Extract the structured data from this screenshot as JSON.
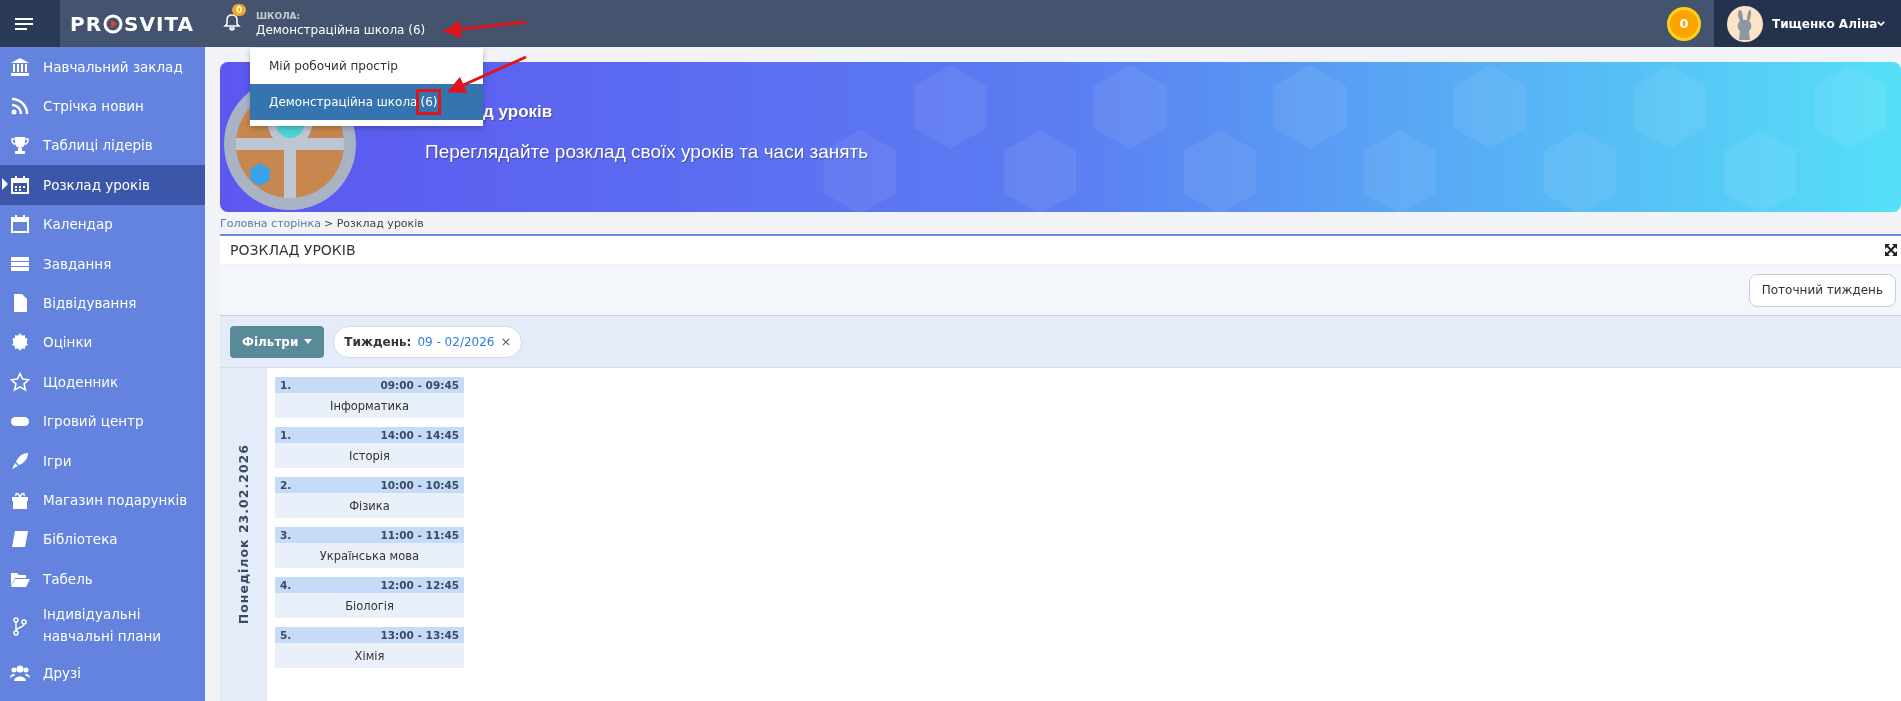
{
  "header": {
    "logo": {
      "before": "PR",
      "after": "SVITA"
    },
    "notifications": "0",
    "school_label": "ШКОЛА:",
    "school_name": "Демонстраційна школа (6)",
    "coins": "0",
    "user_name": "Тищенко Аліна"
  },
  "school_menu": [
    {
      "label": "Мій робочий простір",
      "selected": false,
      "highlighted": false
    },
    {
      "label": "Демонстраційна школа",
      "count": "(6)",
      "selected": true,
      "highlighted": true
    }
  ],
  "sidebar": {
    "items": [
      {
        "label": "Навчальний заклад",
        "selected": false
      },
      {
        "label": "Стрічка новин",
        "selected": false
      },
      {
        "label": "Таблиці лідерів",
        "selected": false
      },
      {
        "label": "Розклад уроків",
        "selected": true
      },
      {
        "label": "Календар",
        "selected": false
      },
      {
        "label": "Завдання",
        "selected": false
      },
      {
        "label": "Відвідування",
        "selected": false
      },
      {
        "label": "Оцінки",
        "selected": false
      },
      {
        "label": "Щоденник",
        "selected": false
      },
      {
        "label": "Ігровий центр",
        "selected": false
      },
      {
        "label": "Ігри",
        "selected": false
      },
      {
        "label": "Магазин подарунків",
        "selected": false
      },
      {
        "label": "Бібліотека",
        "selected": false
      },
      {
        "label": "Табель",
        "selected": false
      },
      {
        "label": "Індивідуальні навчальні плани",
        "selected": false
      },
      {
        "label": "Друзі",
        "selected": false
      }
    ]
  },
  "banner": {
    "title": "д уроків",
    "subtitle": "Переглядайте розклад своїх уроків та часи занять"
  },
  "breadcrumb": {
    "link": "Головна сторінка",
    "current": "> Розклад уроків"
  },
  "panel": {
    "title": "РОЗКЛАД УРОКІВ",
    "current_week_button": "Поточний тиждень",
    "filters_button": "Фільтри",
    "filter_chip": {
      "label": "Тиждень:",
      "value": "09 - 02/2026",
      "remove": "×"
    }
  },
  "schedule": {
    "days": [
      {
        "label": "Понеділок 23.02.2026",
        "lessons": [
          {
            "number": "1.",
            "time": "09:00 - 09:45",
            "subject": "Інформатика"
          },
          {
            "number": "1.",
            "time": "14:00 - 14:45",
            "subject": "Історія"
          },
          {
            "number": "2.",
            "time": "10:00 - 10:45",
            "subject": "Фізика"
          },
          {
            "number": "3.",
            "time": "11:00 - 11:45",
            "subject": "Українська мова"
          },
          {
            "number": "4.",
            "time": "12:00 - 12:45",
            "subject": "Біологія"
          },
          {
            "number": "5.",
            "time": "13:00 - 13:45",
            "subject": "Хімія"
          }
        ]
      }
    ]
  }
}
